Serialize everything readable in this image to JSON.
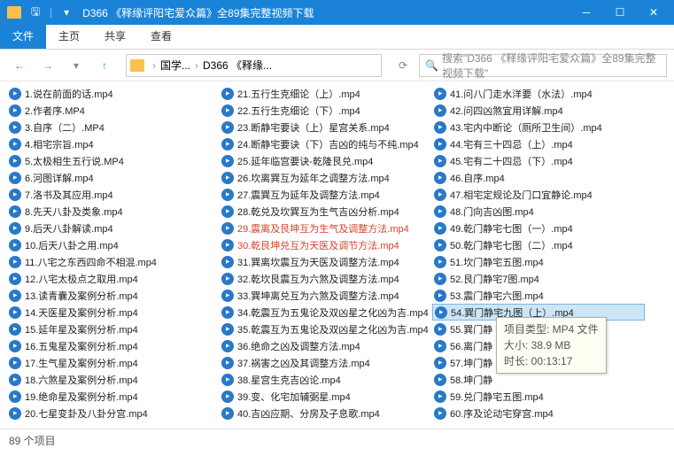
{
  "window": {
    "title": "D366 《释缘评阳宅爱众篇》全89集完整视频下载"
  },
  "ribbon": {
    "tabs": [
      "文件",
      "主页",
      "共享",
      "查看"
    ]
  },
  "breadcrumb": {
    "items": [
      "国学...",
      "D366 《释缘..."
    ]
  },
  "search": {
    "placeholder": "搜索\"D366 《释缘评阳宅爱众篇》全89集完整视频下载\""
  },
  "tooltip": {
    "l1": "项目类型: MP4 文件",
    "l2": "大小: 38.9 MB",
    "l3": "时长: 00:13:17"
  },
  "status": {
    "text": "89 个项目"
  },
  "files": [
    {
      "n": "1.说在前面的话.mp4",
      "s": 1
    },
    {
      "n": "2.作者序.MP4"
    },
    {
      "n": "3.自序（二）.MP4"
    },
    {
      "n": "4.相宅宗旨.mp4"
    },
    {
      "n": "5.太极相生五行说.MP4"
    },
    {
      "n": "6.河图详解.mp4"
    },
    {
      "n": "7.洛书及其应用.mp4"
    },
    {
      "n": "8.先天八卦及类象.mp4"
    },
    {
      "n": "9.后天八卦解读.mp4"
    },
    {
      "n": "10.后天八卦之用.mp4"
    },
    {
      "n": "11.八宅之东西四命不相混.mp4"
    },
    {
      "n": "12.八宅太极点之取用.mp4"
    },
    {
      "n": "13.读青囊及案例分析.mp4"
    },
    {
      "n": "14.天医星及案例分析.mp4"
    },
    {
      "n": "15.延年星及案例分析.mp4"
    },
    {
      "n": "16.五鬼星及案例分析.mp4"
    },
    {
      "n": "17.生气星及案例分析.mp4"
    },
    {
      "n": "18.六煞星及案例分析.mp4"
    },
    {
      "n": "19.绝命星及案例分析.mp4"
    },
    {
      "n": "20.七星变卦及八卦分宫.mp4"
    },
    {
      "n": "21.五行生克细论（上）.mp4"
    },
    {
      "n": "22.五行生克细论（下）.mp4"
    },
    {
      "n": "23.断静宅要诀（上）星宫关系.mp4"
    },
    {
      "n": "24.断静宅要诀（下）吉凶的纯与不纯.mp4"
    },
    {
      "n": "25.延年临宫要诀-乾隆艮兑.mp4"
    },
    {
      "n": "26.坎离巽互为延年之调整方法.mp4"
    },
    {
      "n": "27.震巽互为延年及调整方法.mp4"
    },
    {
      "n": "28.乾兑及坎巽互为生气吉凶分析.mp4"
    },
    {
      "n": "29.震离及艮坤互为生气及调整方法.mp4",
      "h": 1
    },
    {
      "n": "30.乾艮坤兑互为天医及调节方法.mp4",
      "h": 1
    },
    {
      "n": "31.巽离坎震互为天医及调整方法.mp4"
    },
    {
      "n": "32.乾坎艮震互为六煞及调整方法.mp4"
    },
    {
      "n": "33.巽坤离兑互为六煞及调整方法.mp4"
    },
    {
      "n": "34.乾震互为五鬼论及双凶星之化凶为吉.mp4"
    },
    {
      "n": "35.乾震互为五鬼论及双凶星之化凶为吉.mp4"
    },
    {
      "n": "36.绝命之凶及调整方法.mp4"
    },
    {
      "n": "37.祸害之凶及其调整方法.mp4"
    },
    {
      "n": "38.星宫生克吉凶论.mp4"
    },
    {
      "n": "39.变、化宅加辅弼星.mp4"
    },
    {
      "n": "40.吉凶应期、分房及子息歌.mp4"
    },
    {
      "n": "41.问八门走水洋要（水法）.mp4"
    },
    {
      "n": "42.问四凶煞宜用详解.mp4"
    },
    {
      "n": "43.宅内中断论（厕所卫生间）.mp4"
    },
    {
      "n": "44.宅有三十四忌（上）.mp4"
    },
    {
      "n": "45.宅有二十四忌（下）.mp4"
    },
    {
      "n": "46.自序.mp4"
    },
    {
      "n": "47.相宅定规论及门口宜静论.mp4"
    },
    {
      "n": "48.门向吉凶图.mp4"
    },
    {
      "n": "49.乾门静宅七图（一）.mp4"
    },
    {
      "n": "50.乾门静宅七图（二）.mp4"
    },
    {
      "n": "51.坎门静宅五图.mp4"
    },
    {
      "n": "52.艮门静宅7图.mp4"
    },
    {
      "n": "53.震门静宅六图.mp4"
    },
    {
      "n": "54.巽门静宅九图（上）.mp4",
      "sel": 1
    },
    {
      "n": "55.巽门静"
    },
    {
      "n": "56.离门静"
    },
    {
      "n": "57.坤门静"
    },
    {
      "n": "58.坤门静"
    },
    {
      "n": "59.兑门静宅五图.mp4"
    },
    {
      "n": "60.序及论动宅穿宫.mp4"
    }
  ]
}
